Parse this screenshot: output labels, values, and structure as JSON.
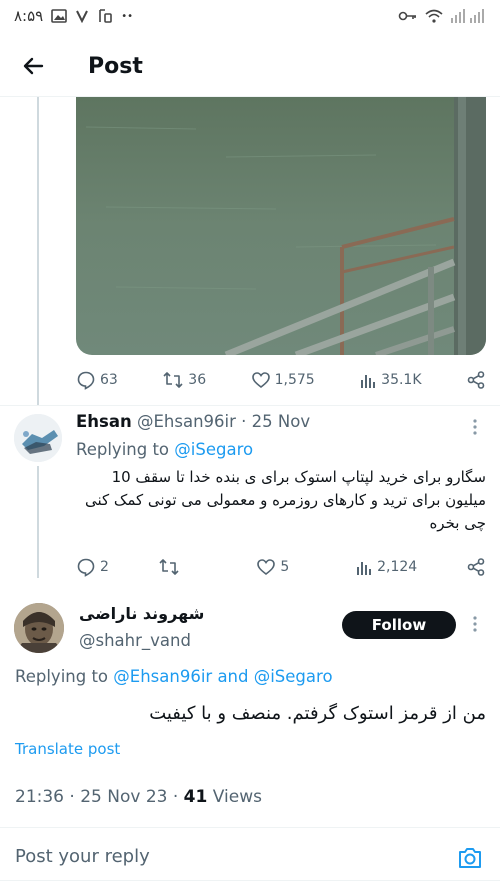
{
  "status_bar": {
    "time": "۸:۵۹",
    "dots": "••",
    "signal_icons": [
      "image-icon",
      "v-icon",
      "sim-icon",
      "key-icon",
      "wifi-icon",
      "signal-icon"
    ]
  },
  "header": {
    "title": "Post"
  },
  "parent_post": {
    "stats": {
      "replies": "63",
      "reposts": "36",
      "likes": "1,575",
      "views": "35.1K"
    }
  },
  "reply1": {
    "name": "Ehsan",
    "handle": "@Ehsan96ir",
    "date": "· 25 Nov",
    "replying_label": "Replying to",
    "replying_to": "@iSegaro",
    "text": "سگارو برای خرید لپتاپ استوک برای ی بنده خدا تا سقف 10 میلیون برای ترید و کارهای روزمره و معمولی می تونی کمک کنی چی بخره",
    "stats": {
      "replies": "2",
      "reposts": "",
      "likes": "5",
      "views": "2,124"
    }
  },
  "main_post": {
    "name": "شهروند ناراضی",
    "handle": "@shahr_vand",
    "follow_label": "Follow",
    "replying_label": "Replying to",
    "replying_to": "@Ehsan96ir and @iSegaro",
    "text": "من از قرمز استوک گرفتم. منصف و با کیفیت",
    "translate_label": "Translate post",
    "timestamp": "21:36 · 25 Nov 23 ·",
    "views_count": "41",
    "views_label": "Views"
  },
  "reply_bar": {
    "placeholder": "Post your reply"
  },
  "colors": {
    "accent": "#1d9bf0",
    "text": "#0f1419",
    "secondary": "#536471",
    "follow_bg": "#0f1419"
  }
}
